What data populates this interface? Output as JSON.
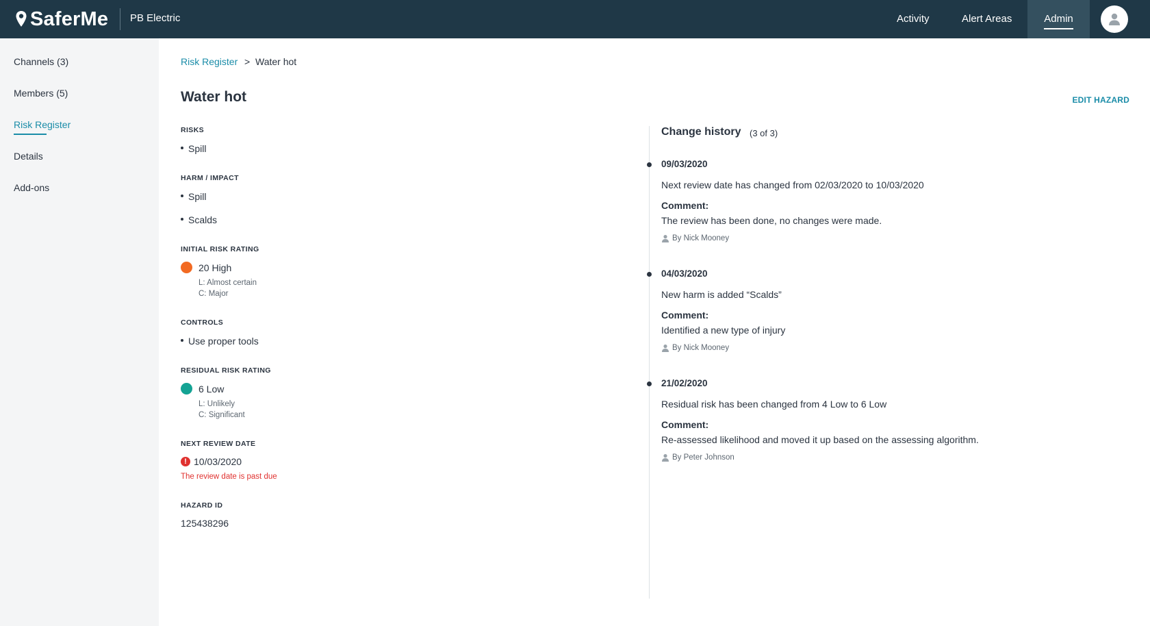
{
  "header": {
    "logo_text": "SaferMe",
    "org_name": "PB Electric",
    "nav": {
      "activity": "Activity",
      "alert_areas": "Alert Areas",
      "admin": "Admin"
    }
  },
  "sidebar": {
    "items": [
      {
        "label": "Channels (3)"
      },
      {
        "label": "Members (5)"
      },
      {
        "label": "Risk Register"
      },
      {
        "label": "Details"
      },
      {
        "label": "Add-ons"
      }
    ]
  },
  "breadcrumb": {
    "parent": "Risk Register",
    "separator": ">",
    "current": "Water hot"
  },
  "hazard": {
    "title": "Water hot",
    "edit_label": "EDIT HAZARD",
    "risks_label": "RISKS",
    "risks": [
      "Spill"
    ],
    "harm_label": "HARM / IMPACT",
    "harms": [
      "Spill",
      "Scalds"
    ],
    "initial_label": "INITIAL RISK RATING",
    "initial": {
      "rating": "20 High",
      "likelihood": "L: Almost certain",
      "consequence": "C: Major",
      "color": "#f26a22"
    },
    "controls_label": "CONTROLS",
    "controls": [
      "Use proper tools"
    ],
    "residual_label": "RESIDUAL RISK RATING",
    "residual": {
      "rating": "6 Low",
      "likelihood": "L: Unlikely",
      "consequence": "C: Significant",
      "color": "#14a394"
    },
    "review_label": "NEXT REVIEW DATE",
    "review_date": "10/03/2020",
    "review_warning": "The review date is past due",
    "id_label": "HAZARD ID",
    "id": "125438296"
  },
  "history": {
    "title": "Change history",
    "count": "(3 of 3)",
    "comment_label": "Comment:",
    "entries": [
      {
        "date": "09/03/2020",
        "text": "Next review date has changed from 02/03/2020 to 10/03/2020",
        "comment": "The review has been done, no changes were made.",
        "by": "By Nick Mooney"
      },
      {
        "date": "04/03/2020",
        "text": "New harm is added “Scalds”",
        "comment": "Identified a new type of injury",
        "by": "By Nick Mooney"
      },
      {
        "date": "21/02/2020",
        "text": "Residual risk has been changed from 4 Low to 6 Low",
        "comment": "Re-assessed likelihood and moved it up based on the assessing algorithm.",
        "by": "By Peter Johnson"
      }
    ]
  }
}
